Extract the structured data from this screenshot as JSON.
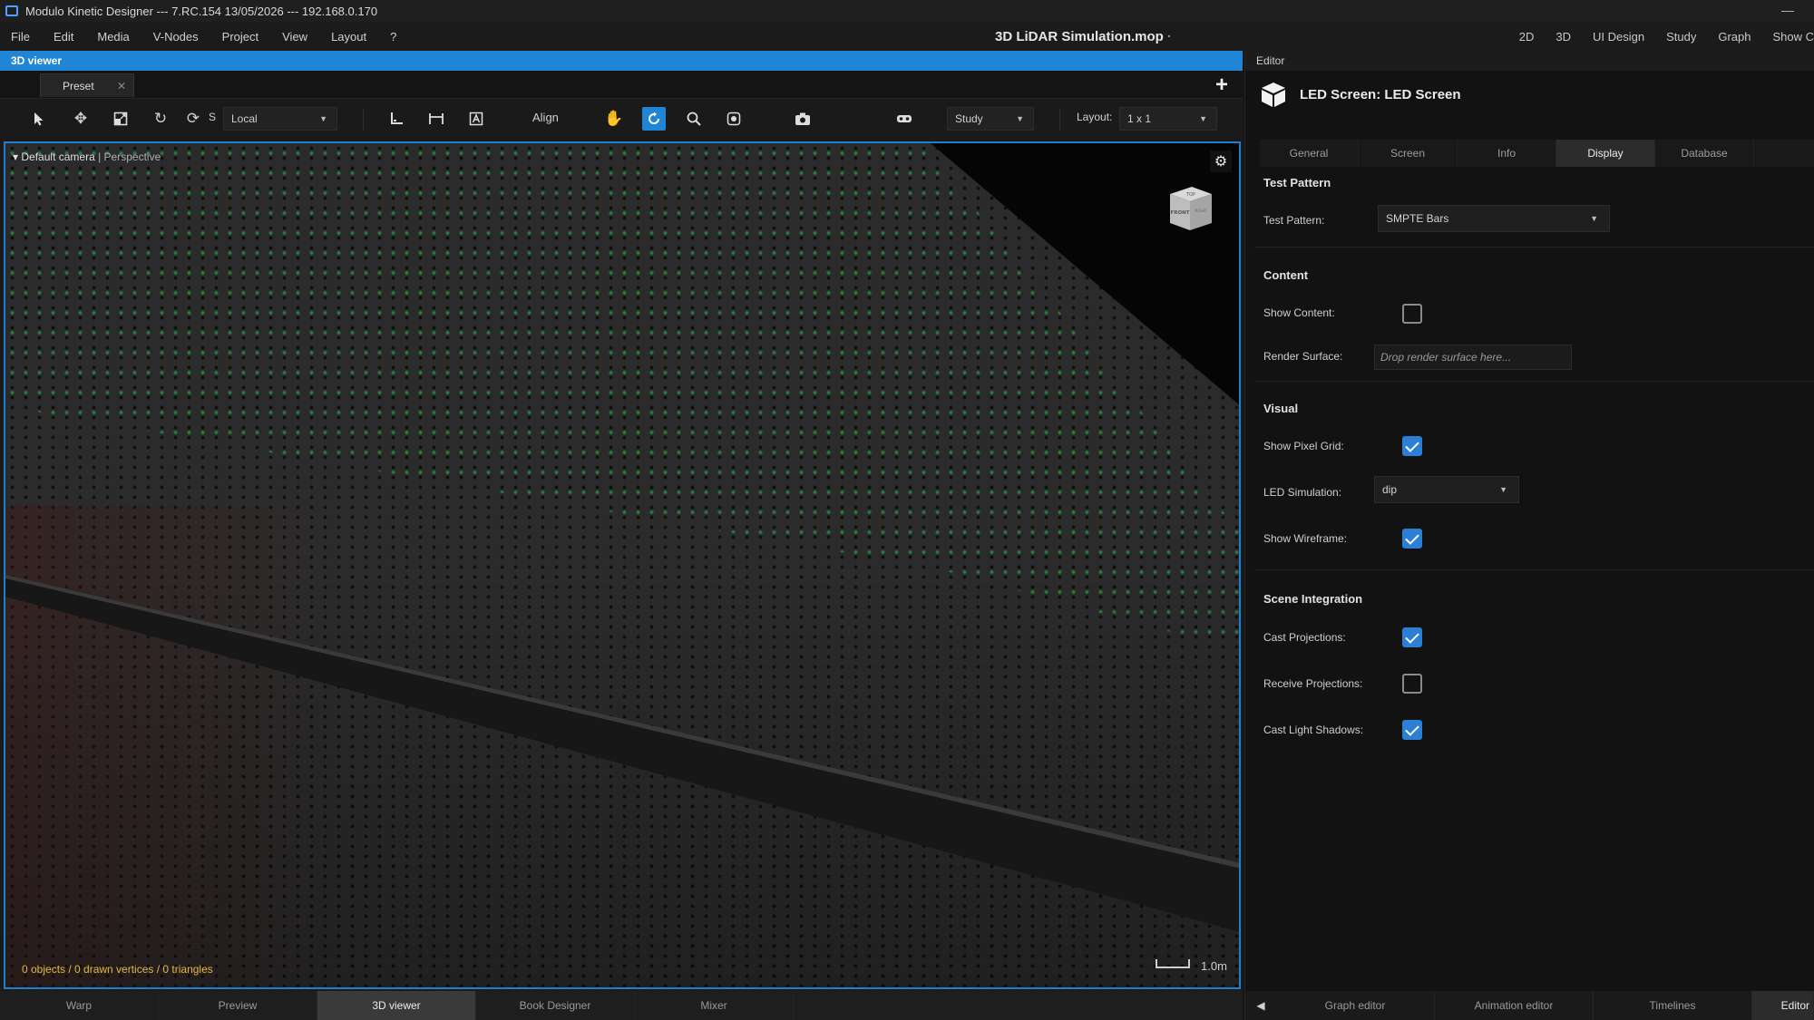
{
  "window": {
    "title": "Modulo Kinetic Designer --- 7.RC.154 13/05/2026 --- 192.168.0.170",
    "project": "3D LiDAR Simulation.mop",
    "project_marker": "·"
  },
  "menu": [
    "File",
    "Edit",
    "Media",
    "V-Nodes",
    "Project",
    "View",
    "Layout",
    "?"
  ],
  "perspectives": [
    "2D",
    "3D",
    "UI Design",
    "Study",
    "Graph",
    "Show C"
  ],
  "viewer": {
    "header": "3D viewer",
    "preset_tab": "Preset",
    "toolbar": {
      "rotate_letter": "S",
      "space_select": "Local",
      "align_label": "Align",
      "study_select": "Study",
      "layout_label": "Layout:",
      "layout_select": "1 x 1"
    },
    "camera": "Default camera",
    "projection": "Perspective",
    "nav_cube": {
      "top": "TOP",
      "front": "FRONT",
      "right": "RIGHT"
    },
    "stats": "0 objects / 0 drawn vertices / 0 triangles",
    "scale": "1.0m"
  },
  "bottom_tabs": [
    "Warp",
    "Preview",
    "3D viewer",
    "Book Designer",
    "Mixer"
  ],
  "bottom_tab_active": 2,
  "editor": {
    "header": "Editor",
    "title": "LED Screen: LED Screen",
    "tabs": [
      "General",
      "Screen",
      "Info",
      "Display",
      "Database"
    ],
    "active_tab": 3,
    "sections": {
      "test_pattern": "Test Pattern",
      "content": "Content",
      "visual": "Visual",
      "scene": "Scene Integration"
    },
    "props": {
      "test_pattern": {
        "label": "Test Pattern:",
        "value": "SMPTE Bars"
      },
      "show_content": {
        "label": "Show Content:",
        "checked": false
      },
      "render_surface": {
        "label": "Render Surface:",
        "placeholder": "Drop render surface here..."
      },
      "show_pixel_grid": {
        "label": "Show Pixel Grid:",
        "checked": true
      },
      "led_simulation": {
        "label": "LED Simulation:",
        "value": "dip"
      },
      "show_wireframe": {
        "label": "Show Wireframe:",
        "checked": true
      },
      "cast_projections": {
        "label": "Cast Projections:",
        "checked": true
      },
      "receive_projections": {
        "label": "Receive Projections:",
        "checked": false
      },
      "cast_light_shadows": {
        "label": "Cast Light Shadows:",
        "checked": true
      }
    },
    "bottom_tabs": [
      "Graph editor",
      "Animation editor",
      "Timelines",
      "Editor"
    ]
  },
  "colors": {
    "accent": "#2185d6",
    "checkbox_on": "#2b7fd4",
    "stats_text": "#e5b83c",
    "led_green": "#1f8a3c"
  }
}
